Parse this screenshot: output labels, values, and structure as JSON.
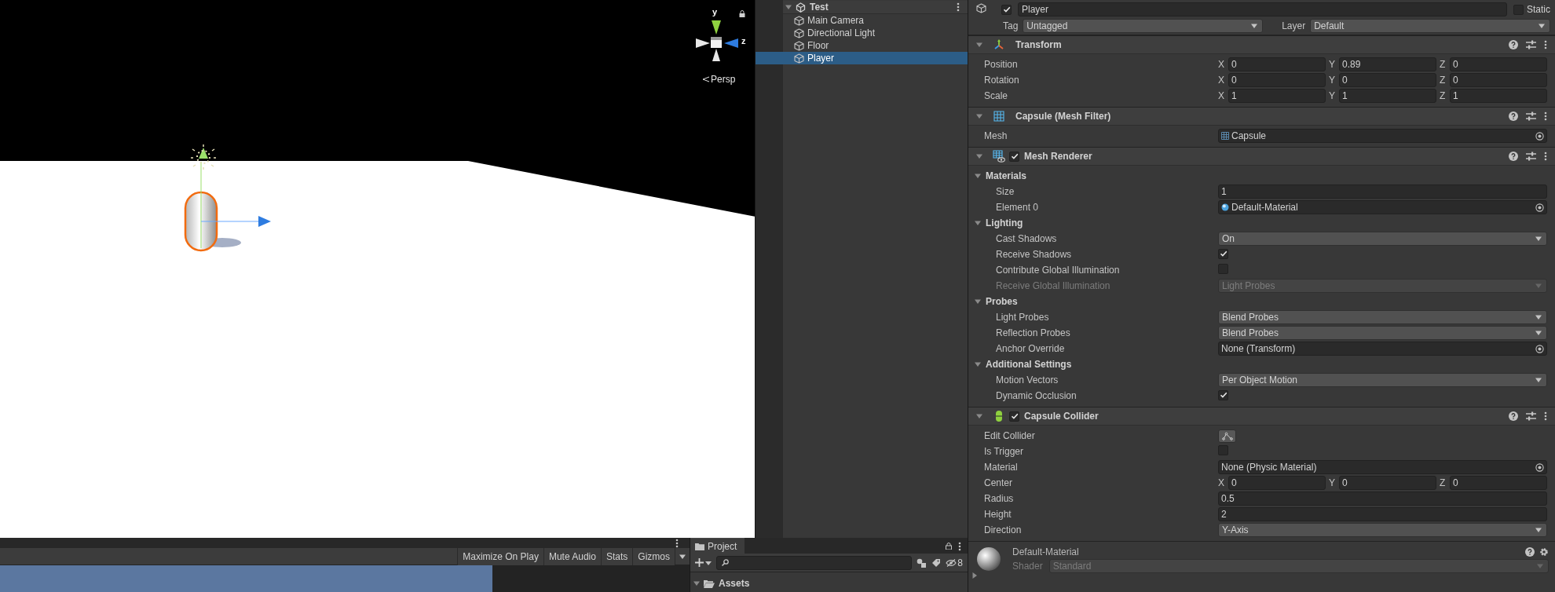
{
  "scene_view": {
    "gizmo_axes": [
      "y",
      "z"
    ],
    "projection": "Persp"
  },
  "hierarchy": {
    "scene": "Test",
    "expanded": true,
    "items": [
      {
        "label": "Main Camera",
        "selected": false
      },
      {
        "label": "Directional Light",
        "selected": false
      },
      {
        "label": "Floor",
        "selected": false
      },
      {
        "label": "Player",
        "selected": true
      }
    ]
  },
  "inspector": {
    "active": true,
    "name": "Player",
    "static": false,
    "static_label": "Static",
    "tag_label": "Tag",
    "tag": "Untagged",
    "layer_label": "Layer",
    "layer": "Default",
    "components": [
      {
        "title": "Transform",
        "kind": "transform",
        "expanded": true,
        "rows": [
          {
            "kind": "vector3",
            "label": "Position",
            "axes": [
              "X",
              "Y",
              "Z"
            ],
            "values": [
              "0",
              "0.89",
              "0"
            ]
          },
          {
            "kind": "vector3",
            "label": "Rotation",
            "axes": [
              "X",
              "Y",
              "Z"
            ],
            "values": [
              "0",
              "0",
              "0"
            ]
          },
          {
            "kind": "vector3",
            "label": "Scale",
            "axes": [
              "X",
              "Y",
              "Z"
            ],
            "values": [
              "1",
              "1",
              "1"
            ]
          }
        ]
      },
      {
        "title": "Capsule (Mesh Filter)",
        "kind": "mesh_filter",
        "expanded": true,
        "rows": [
          {
            "kind": "object",
            "label": "Mesh",
            "value": "Capsule",
            "asset": {
              "kind": "mesh"
            }
          }
        ]
      },
      {
        "title": "Mesh Renderer",
        "kind": "mesh_renderer",
        "enabled": true,
        "expanded": true,
        "rows": [
          {
            "kind": "section",
            "label": "Materials",
            "expanded": true,
            "children": [
              {
                "kind": "number",
                "label": "Size",
                "value": "1"
              },
              {
                "kind": "object",
                "label": "Element 0",
                "value": "Default-Material",
                "asset": {
                  "kind": "material"
                }
              }
            ]
          },
          {
            "kind": "section",
            "label": "Lighting",
            "expanded": true,
            "children": [
              {
                "kind": "dropdown",
                "label": "Cast Shadows",
                "value": "On",
                "disabled": false
              },
              {
                "kind": "checkbox",
                "label": "Receive Shadows",
                "checked": true
              },
              {
                "kind": "checkbox",
                "label": "Contribute Global Illumination",
                "checked": false
              },
              {
                "kind": "dropdown",
                "label": "Receive Global Illumination",
                "value": "Light Probes",
                "disabled": true
              }
            ]
          },
          {
            "kind": "section",
            "label": "Probes",
            "expanded": true,
            "children": [
              {
                "kind": "dropdown",
                "label": "Light Probes",
                "value": "Blend Probes",
                "disabled": false
              },
              {
                "kind": "dropdown",
                "label": "Reflection Probes",
                "value": "Blend Probes",
                "disabled": false
              },
              {
                "kind": "object",
                "label": "Anchor Override",
                "value": "None (Transform)"
              }
            ]
          },
          {
            "kind": "section",
            "label": "Additional Settings",
            "expanded": true,
            "children": [
              {
                "kind": "dropdown",
                "label": "Motion Vectors",
                "value": "Per Object Motion",
                "disabled": false
              },
              {
                "kind": "checkbox",
                "label": "Dynamic Occlusion",
                "checked": true
              }
            ]
          }
        ]
      },
      {
        "title": "Capsule Collider",
        "kind": "capsule_collider",
        "enabled": true,
        "expanded": true,
        "rows": [
          {
            "kind": "button",
            "label": "Edit Collider"
          },
          {
            "kind": "checkbox",
            "label": "Is Trigger",
            "checked": false
          },
          {
            "kind": "object",
            "label": "Material",
            "value": "None (Physic Material)"
          },
          {
            "kind": "vector3",
            "label": "Center",
            "axes": [
              "X",
              "Y",
              "Z"
            ],
            "values": [
              "0",
              "0",
              "0"
            ]
          },
          {
            "kind": "number",
            "label": "Radius",
            "value": "0.5"
          },
          {
            "kind": "number",
            "label": "Height",
            "value": "2"
          },
          {
            "kind": "dropdown",
            "label": "Direction",
            "value": "Y-Axis",
            "disabled": false
          }
        ]
      }
    ],
    "material_preview": {
      "name": "Default-Material",
      "shader_label": "Shader",
      "shader": "Standard",
      "expanded": false
    }
  },
  "game_view": {
    "toolbar": [
      "Maximize On Play",
      "Mute Audio",
      "Stats",
      "Gizmos"
    ]
  },
  "project": {
    "tab": "Project",
    "hidden_count": "8",
    "tree": [
      {
        "label": "Assets",
        "expanded": true
      }
    ]
  }
}
